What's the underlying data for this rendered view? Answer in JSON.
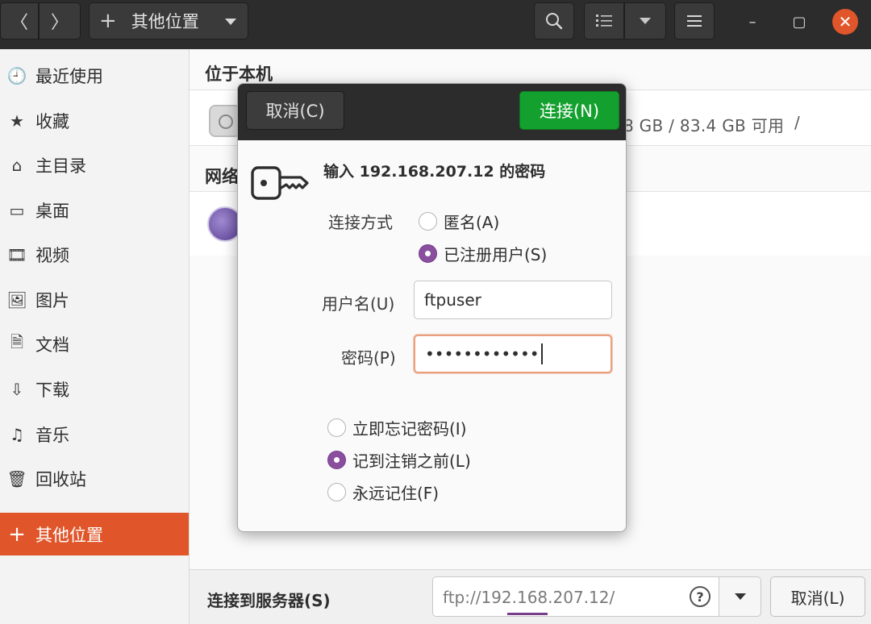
{
  "header": {
    "path_label": "其他位置",
    "path_plus": "+",
    "back_glyph": "〈",
    "forward_glyph": "〉",
    "search_icon": "search-icon",
    "menu_icon": "hamburger-icon",
    "win_minimize": "–",
    "win_maximize": "▢",
    "win_close": "✕",
    "close_color": "#e0562a"
  },
  "sidebar": {
    "items": [
      {
        "label": "最近使用",
        "icon": "clock-icon",
        "glyph": "🕘"
      },
      {
        "label": "收藏",
        "icon": "star-icon",
        "glyph": "★"
      },
      {
        "label": "主目录",
        "icon": "home-icon",
        "glyph": "⌂"
      },
      {
        "label": "桌面",
        "icon": "desktop-icon",
        "glyph": "▭"
      },
      {
        "label": "视频",
        "icon": "film-icon",
        "glyph": "🎞"
      },
      {
        "label": "图片",
        "icon": "picture-icon",
        "glyph": "🖼"
      },
      {
        "label": "文档",
        "icon": "document-icon",
        "glyph": "🗎"
      },
      {
        "label": "下载",
        "icon": "download-icon",
        "glyph": "⇩"
      },
      {
        "label": "音乐",
        "icon": "music-icon",
        "glyph": "♫"
      },
      {
        "label": "回收站",
        "icon": "trash-icon",
        "glyph": "🗑"
      },
      {
        "label": "其他位置",
        "icon": "plus-icon",
        "glyph": "+",
        "active": true
      }
    ],
    "accent": "#e0562a"
  },
  "main": {
    "local_title": "位于本机",
    "network_title": "网络",
    "disk_info": "8 GB / 83.4 GB 可用",
    "disk_mount": "/"
  },
  "bottom": {
    "label": "连接到服务器(S)",
    "server_value": "ftp://192.168.207.12/",
    "help_glyph": "?",
    "cancel_label": "取消(L)"
  },
  "dialog": {
    "cancel_label": "取消(C)",
    "connect_label": "连接(N)",
    "connect_color": "#14a02e",
    "prompt": "输入 192.168.207.12 的密码",
    "connect_method_label": "连接方式",
    "anonymous_label": "匿名(A)",
    "registered_label": "已注册用户(S)",
    "username_label": "用户名(U)",
    "username_value": "ftpuser",
    "password_label": "密码(P)",
    "password_value": "••••••••••••",
    "forget_label": "立即忘记密码(I)",
    "remember_session_label": "记到注销之前(L)",
    "remember_forever_label": "永远记住(F)",
    "radio_accent": "#8a4e9e"
  }
}
